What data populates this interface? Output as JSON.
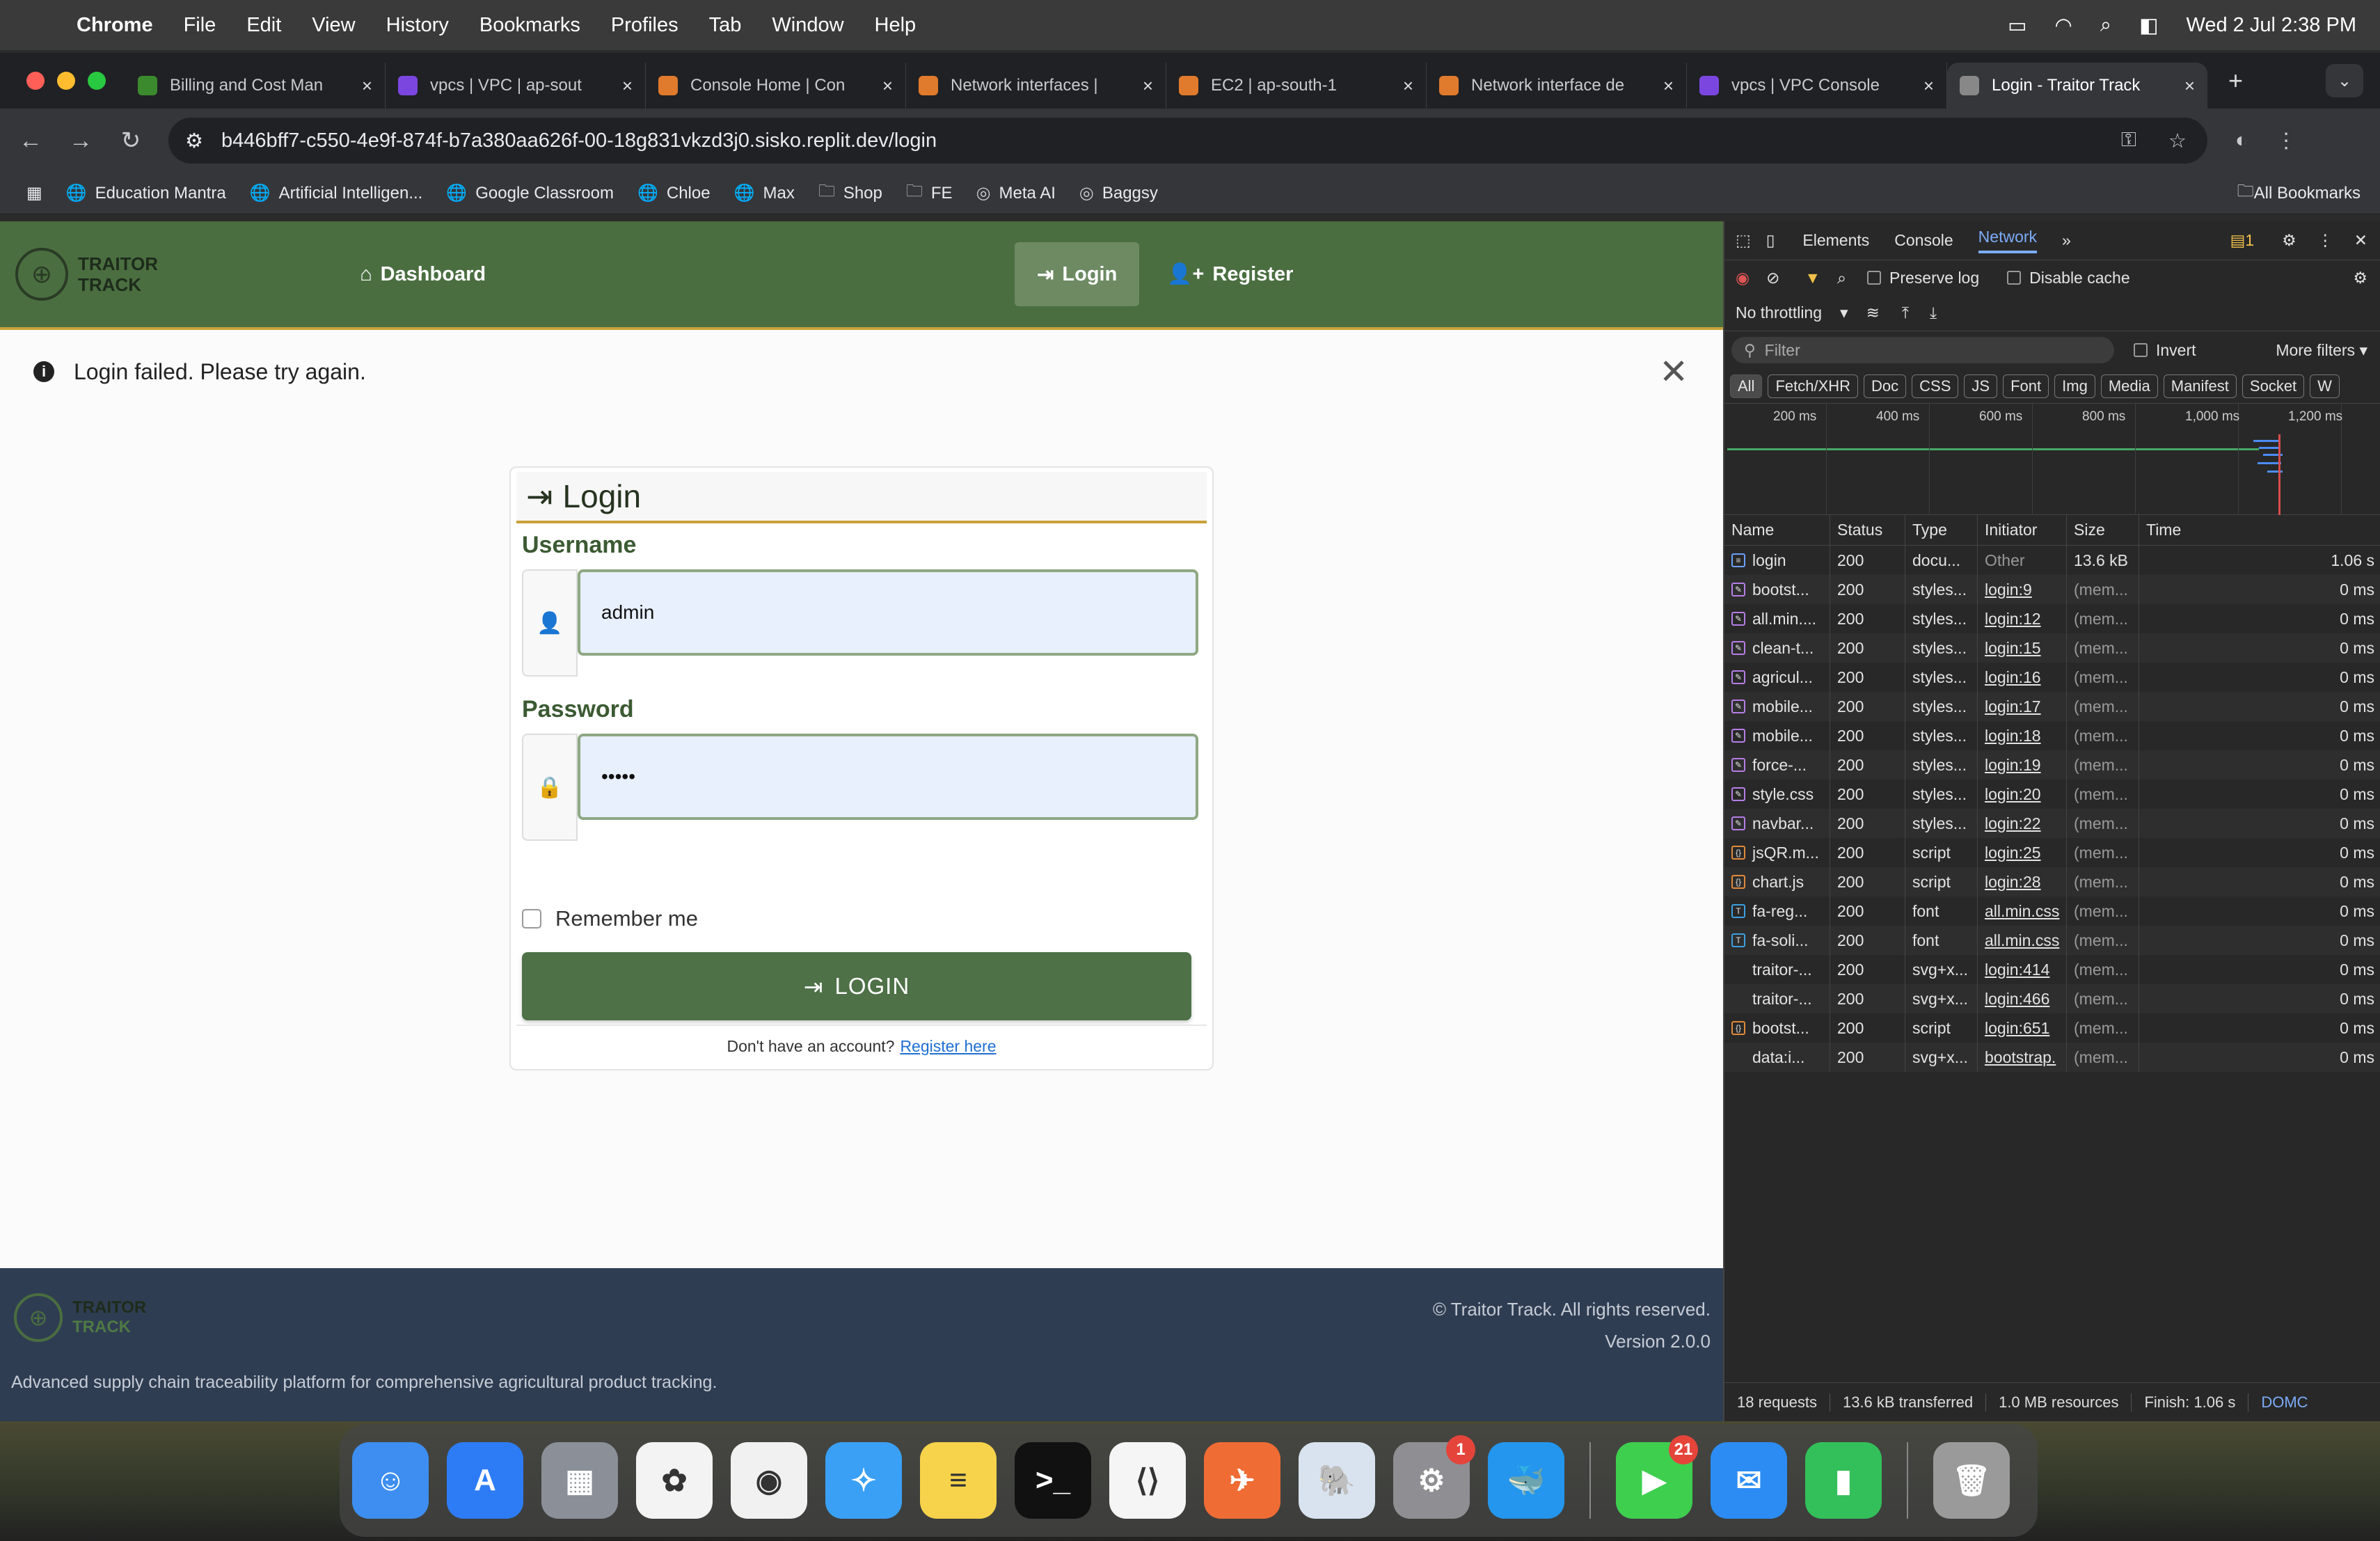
{
  "menubar": {
    "app": "Chrome",
    "items": [
      "File",
      "Edit",
      "View",
      "History",
      "Bookmarks",
      "Profiles",
      "Tab",
      "Window",
      "Help"
    ],
    "datetime": "Wed 2 Jul  2:38 PM"
  },
  "tabs": [
    {
      "title": "Billing and Cost Man",
      "color": "#3c8a2e"
    },
    {
      "title": "vpcs | VPC | ap-sout",
      "color": "#7b46e0"
    },
    {
      "title": "Console Home | Con",
      "color": "#e07a2c"
    },
    {
      "title": "Network interfaces |",
      "color": "#e07a2c"
    },
    {
      "title": "EC2 | ap-south-1",
      "color": "#e07a2c"
    },
    {
      "title": "Network interface de",
      "color": "#e07a2c"
    },
    {
      "title": "vpcs | VPC Console",
      "color": "#7b46e0"
    },
    {
      "title": "Login - Traitor Track",
      "color": "#888888",
      "active": true
    }
  ],
  "address": {
    "url": "b446bff7-c550-4e9f-874f-b7a380aa626f-00-18g831vkzd3j0.sisko.replit.dev/login"
  },
  "bookmarks": {
    "items": [
      "Education Mantra",
      "Artificial Intelligen...",
      "Google Classroom",
      "Chloe",
      "Max",
      "Shop",
      "FE",
      "Meta AI",
      "Baggsy"
    ],
    "all": "All Bookmarks"
  },
  "site": {
    "brand_line1": "TRAITOR",
    "brand_line2": "TRACK",
    "nav_dashboard": "Dashboard",
    "nav_login": "Login",
    "nav_register": "Register",
    "alert": "Login failed. Please try again.",
    "card_title": "Login",
    "username_label": "Username",
    "username_value": "admin",
    "password_label": "Password",
    "password_value": "•••••",
    "remember_label": "Remember me",
    "login_button": "LOGIN",
    "no_account": "Don't have an account?",
    "register_link": "Register here",
    "footer_copy": "© Traitor Track. All rights reserved.",
    "footer_version": "Version 2.0.0",
    "footer_desc": "Advanced supply chain traceability platform for comprehensive agricultural product tracking."
  },
  "devtools": {
    "tabs": [
      "Elements",
      "Console",
      "Network"
    ],
    "active_tab": "Network",
    "issues": "1",
    "preserve_log": "Preserve log",
    "disable_cache": "Disable cache",
    "throttling": "No throttling",
    "filter_placeholder": "Filter",
    "invert": "Invert",
    "more_filters": "More filters",
    "type_filters": [
      "All",
      "Fetch/XHR",
      "Doc",
      "CSS",
      "JS",
      "Font",
      "Img",
      "Media",
      "Manifest",
      "Socket",
      "W"
    ],
    "timeline_labels": [
      "200 ms",
      "400 ms",
      "600 ms",
      "800 ms",
      "1,000 ms",
      "1,200 ms"
    ],
    "columns": [
      "Name",
      "Status",
      "Type",
      "Initiator",
      "Size",
      "Time"
    ],
    "rows": [
      {
        "name": "login",
        "status": "200",
        "type": "docu...",
        "initiator": "Other",
        "size": "13.6 kB",
        "time": "1.06 s",
        "kind": "doc"
      },
      {
        "name": "bootst...",
        "status": "200",
        "type": "styles...",
        "initiator": "login:9",
        "size": "(mem...",
        "time": "0 ms",
        "kind": "css"
      },
      {
        "name": "all.min....",
        "status": "200",
        "type": "styles...",
        "initiator": "login:12",
        "size": "(mem...",
        "time": "0 ms",
        "kind": "css"
      },
      {
        "name": "clean-t...",
        "status": "200",
        "type": "styles...",
        "initiator": "login:15",
        "size": "(mem...",
        "time": "0 ms",
        "kind": "css"
      },
      {
        "name": "agricul...",
        "status": "200",
        "type": "styles...",
        "initiator": "login:16",
        "size": "(mem...",
        "time": "0 ms",
        "kind": "css"
      },
      {
        "name": "mobile...",
        "status": "200",
        "type": "styles...",
        "initiator": "login:17",
        "size": "(mem...",
        "time": "0 ms",
        "kind": "css"
      },
      {
        "name": "mobile...",
        "status": "200",
        "type": "styles...",
        "initiator": "login:18",
        "size": "(mem...",
        "time": "0 ms",
        "kind": "css"
      },
      {
        "name": "force-...",
        "status": "200",
        "type": "styles...",
        "initiator": "login:19",
        "size": "(mem...",
        "time": "0 ms",
        "kind": "css"
      },
      {
        "name": "style.css",
        "status": "200",
        "type": "styles...",
        "initiator": "login:20",
        "size": "(mem...",
        "time": "0 ms",
        "kind": "css"
      },
      {
        "name": "navbar...",
        "status": "200",
        "type": "styles...",
        "initiator": "login:22",
        "size": "(mem...",
        "time": "0 ms",
        "kind": "css"
      },
      {
        "name": "jsQR.m...",
        "status": "200",
        "type": "script",
        "initiator": "login:25",
        "size": "(mem...",
        "time": "0 ms",
        "kind": "js"
      },
      {
        "name": "chart.js",
        "status": "200",
        "type": "script",
        "initiator": "login:28",
        "size": "(mem...",
        "time": "0 ms",
        "kind": "js"
      },
      {
        "name": "fa-reg...",
        "status": "200",
        "type": "font",
        "initiator": "all.min.css",
        "size": "(mem...",
        "time": "0 ms",
        "kind": "font"
      },
      {
        "name": "fa-soli...",
        "status": "200",
        "type": "font",
        "initiator": "all.min.css",
        "size": "(mem...",
        "time": "0 ms",
        "kind": "font"
      },
      {
        "name": "traitor-...",
        "status": "200",
        "type": "svg+x...",
        "initiator": "login:414",
        "size": "(mem...",
        "time": "0 ms",
        "kind": "svg"
      },
      {
        "name": "traitor-...",
        "status": "200",
        "type": "svg+x...",
        "initiator": "login:466",
        "size": "(mem...",
        "time": "0 ms",
        "kind": "svg"
      },
      {
        "name": "bootst...",
        "status": "200",
        "type": "script",
        "initiator": "login:651",
        "size": "(mem...",
        "time": "0 ms",
        "kind": "js"
      },
      {
        "name": "data:i...",
        "status": "200",
        "type": "svg+x...",
        "initiator": "bootstrap.",
        "size": "(mem...",
        "time": "0 ms",
        "kind": "svg"
      }
    ],
    "status_bar": [
      "18 requests",
      "13.6 kB transferred",
      "1.0 MB resources",
      "Finish: 1.06 s",
      "DOMC"
    ]
  },
  "dock": {
    "apps": [
      {
        "name": "finder-icon",
        "color": "#3d8ef0"
      },
      {
        "name": "app-store-icon",
        "color": "#2d7cf6"
      },
      {
        "name": "launchpad-icon",
        "color": "#8a8f98"
      },
      {
        "name": "photos-icon",
        "color": "#f3f3f3"
      },
      {
        "name": "chrome-icon",
        "color": "#f1f1f1"
      },
      {
        "name": "safari-icon",
        "color": "#3aa0f5"
      },
      {
        "name": "notes-icon",
        "color": "#f6d34a"
      },
      {
        "name": "terminal-icon",
        "color": "#111111"
      },
      {
        "name": "vscode-icon",
        "color": "#f5f5f5"
      },
      {
        "name": "postman-icon",
        "color": "#ef6c34"
      },
      {
        "name": "pgadmin-icon",
        "color": "#d9e3ef"
      },
      {
        "name": "system-settings-icon",
        "color": "#8e8e93",
        "badge": "1"
      },
      {
        "name": "docker-icon",
        "color": "#2496ed"
      },
      {
        "name": "facetime-icon",
        "color": "#3ecf4f",
        "badge": "21"
      },
      {
        "name": "mail-icon",
        "color": "#2c8cf3"
      },
      {
        "name": "numbers-icon",
        "color": "#33c05a"
      },
      {
        "name": "trash-icon",
        "color": "#9a9a9a"
      }
    ]
  }
}
